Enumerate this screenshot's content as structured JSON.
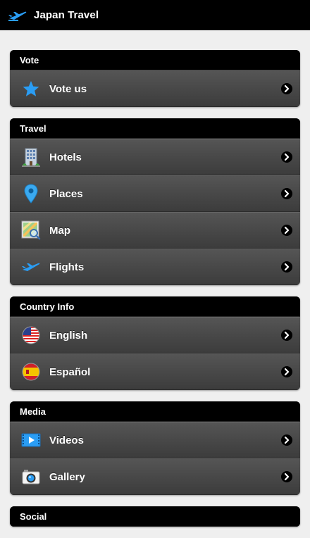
{
  "appbar": {
    "title": "Japan Travel",
    "logo_icon": "airplane-icon"
  },
  "sections": [
    {
      "title": "Vote",
      "items": [
        {
          "label": "Vote us",
          "icon": "star-icon"
        }
      ]
    },
    {
      "title": "Travel",
      "items": [
        {
          "label": "Hotels",
          "icon": "hotel-building-icon"
        },
        {
          "label": "Places",
          "icon": "map-pin-icon"
        },
        {
          "label": "Map",
          "icon": "map-search-icon"
        },
        {
          "label": "Flights",
          "icon": "airplane-icon"
        }
      ]
    },
    {
      "title": "Country Info",
      "items": [
        {
          "label": "English",
          "icon": "us-flag-icon"
        },
        {
          "label": "Español",
          "icon": "spain-flag-icon"
        }
      ]
    },
    {
      "title": "Media",
      "items": [
        {
          "label": "Videos",
          "icon": "video-icon"
        },
        {
          "label": "Gallery",
          "icon": "camera-icon"
        }
      ]
    },
    {
      "title": "Social",
      "items": []
    }
  ],
  "colors": {
    "appbar_bg": "#000000",
    "page_bg": "#efefef",
    "header_bg": "#000000",
    "row_bg": "#4a4a4a",
    "accent_blue": "#2a9df4"
  }
}
